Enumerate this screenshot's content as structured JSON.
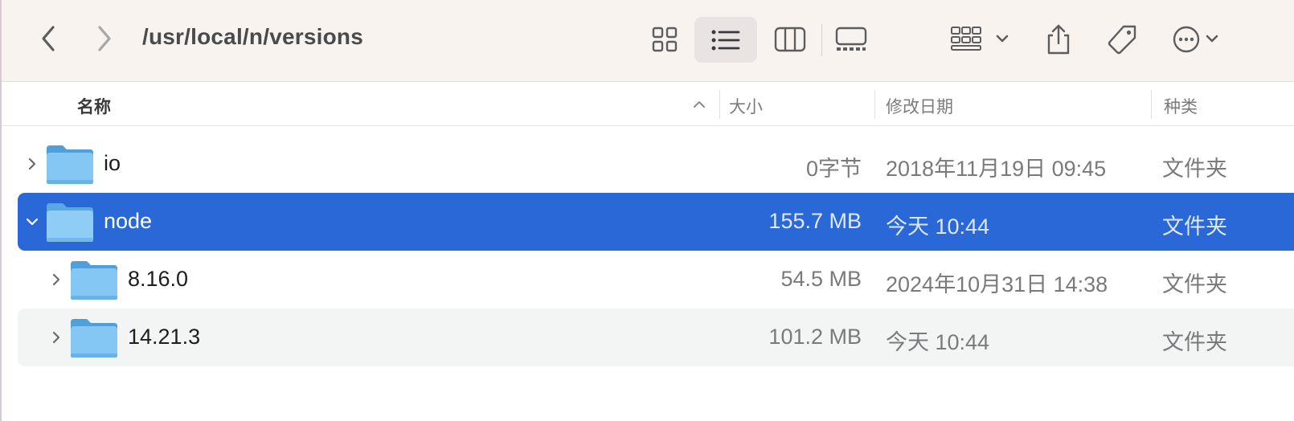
{
  "toolbar": {
    "path_title": "/usr/local/n/versions"
  },
  "columns": {
    "name": "名称",
    "size": "大小",
    "date": "修改日期",
    "kind": "种类"
  },
  "rows": [
    {
      "name": "io",
      "size": "0字节",
      "date": "2018年11月19日 09:45",
      "kind": "文件夹"
    },
    {
      "name": "node",
      "size": "155.7 MB",
      "date": "今天 10:44",
      "kind": "文件夹"
    },
    {
      "name": "8.16.0",
      "size": "54.5 MB",
      "date": "2024年10月31日 14:38",
      "kind": "文件夹"
    },
    {
      "name": "14.21.3",
      "size": "101.2 MB",
      "date": "今天 10:44",
      "kind": "文件夹"
    }
  ],
  "colors": {
    "selection": "#2a68d8",
    "toolbar_bg": "#f8f3ef",
    "folder_blue": "#7cc0f2"
  },
  "icons": {
    "back": "chevron-left-icon",
    "forward": "chevron-right-icon",
    "grid_view": "grid-view-icon",
    "list_view": "list-view-icon",
    "column_view": "column-view-icon",
    "gallery_view": "gallery-view-icon",
    "group": "group-icon",
    "share": "share-icon",
    "tag": "tag-icon",
    "more": "ellipsis-circle-icon",
    "folder": "folder-icon"
  }
}
